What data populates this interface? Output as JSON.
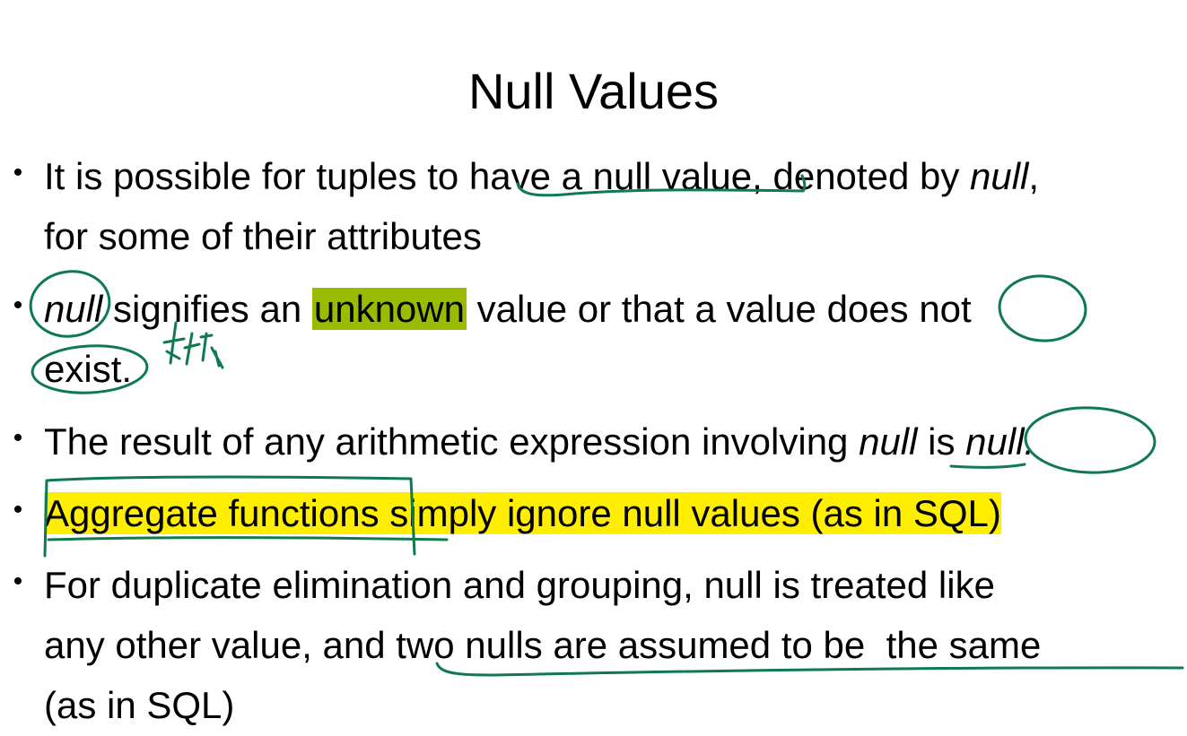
{
  "title": "Null Values",
  "bullet_char": "•",
  "bullets": [
    {
      "lines": [
        [
          "It is possible for tuples to ",
          "have a null value",
          ", denoted by ",
          "null",
          ","
        ],
        [
          "for some of their attributes"
        ]
      ]
    },
    {
      "lines": [
        [
          "null",
          " signifies an ",
          "unknown",
          " value or that a value does ",
          "not"
        ],
        [
          "exist."
        ]
      ]
    },
    {
      "lines": [
        [
          "The result of any arithmetic expression involving ",
          "null",
          " is ",
          "null."
        ]
      ]
    },
    {
      "lines": [
        [
          "Aggregate functions",
          " simply ignore null values (as in SQL)"
        ]
      ]
    },
    {
      "lines": [
        [
          "For duplicate elimination and grouping, null is treated like"
        ],
        [
          "any other value, and ",
          "two nulls are assumed to be  the same"
        ],
        [
          "(as in SQL)"
        ]
      ]
    }
  ],
  "colors": {
    "ink": "#0f7a4f",
    "highlight_green": "#99bb00",
    "highlight_yellow": "#ffee00"
  }
}
